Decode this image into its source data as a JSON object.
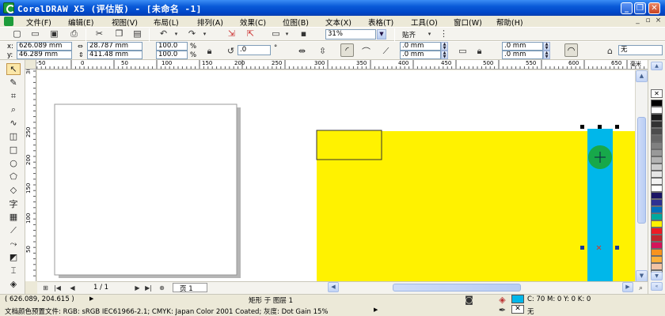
{
  "window": {
    "title": "CorelDRAW X5 (评估版) - [未命名 -1]",
    "minimize_glyph": "_",
    "restore_glyph": "❐",
    "close_glyph": "✕"
  },
  "menu": {
    "items": [
      "文件(F)",
      "编辑(E)",
      "视图(V)",
      "布局(L)",
      "排列(A)",
      "效果(C)",
      "位图(B)",
      "文本(X)",
      "表格(T)",
      "工具(O)",
      "窗口(W)",
      "帮助(H)"
    ],
    "mdi_min": "_",
    "mdi_restore": "▫",
    "mdi_close": "×"
  },
  "standard_toolbar": {
    "zoom_value": "31%",
    "snap_label": "贴齐"
  },
  "property_bar": {
    "x_label": "x:",
    "x_value": "626.089 mm",
    "y_label": "y:",
    "y_value": "46.289 mm",
    "w_value": "28.787 mm",
    "h_value": "411.48 mm",
    "scale_w": "100.0",
    "scale_h": "100.0",
    "pct": "%",
    "rotation": ".0",
    "degree": "°",
    "corner_tl": ".0 mm",
    "corner_bl": ".0 mm",
    "corner_tr": ".0 mm",
    "corner_br": ".0 mm",
    "outline_label": "无"
  },
  "ruler": {
    "top_labels": [
      "-50",
      "0",
      "50",
      "100",
      "150",
      "200",
      "250",
      "300",
      "350",
      "400",
      "450",
      "500",
      "550",
      "600",
      "650"
    ],
    "left_labels": [
      "300",
      "250",
      "200",
      "150",
      "100",
      "50"
    ],
    "unit": "毫米"
  },
  "page_nav": {
    "page_count": "1 / 1",
    "page_tab": "页 1"
  },
  "status": {
    "coords": "( 626.089, 204.615 )",
    "object_info": "矩形 于 图层 1",
    "fill_info": "C: 70 M: 0 Y: 0 K: 0",
    "outline_info": "无",
    "color_profile": "文档颜色预置文件: RGB: sRGB IEC61966-2.1; CMYK: Japan Color 2001 Coated; 灰度: Dot Gain 15%"
  },
  "colors": {
    "yellow_fill": "#fff200",
    "cyan_fill": "#00b7ea",
    "green_circle": "#17a84a",
    "status_fill_swatch": "#00b7ea"
  },
  "palette": [
    "#000000",
    "#ffffff",
    "#1a1a1a",
    "#333333",
    "#4d4d4d",
    "#666666",
    "#808080",
    "#999999",
    "#b3b3b3",
    "#cccccc",
    "#e6e6e6",
    "#f2f2f2",
    "#ffffff",
    "#1b1464",
    "#2e3192",
    "#0071bc",
    "#00a99d",
    "#fff200",
    "#ed1c24",
    "#c1272d",
    "#d4145a",
    "#f7931e",
    "#fbb03b",
    "#f2c3a5",
    "#e6e6e6"
  ]
}
